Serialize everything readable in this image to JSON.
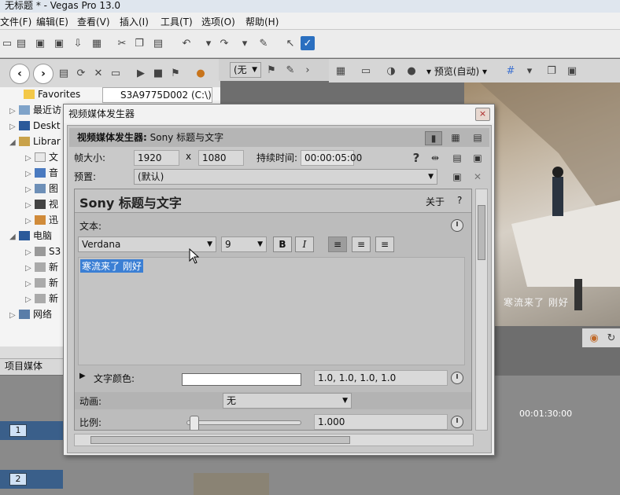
{
  "window": {
    "title": "无标题 * - Vegas Pro 13.0"
  },
  "menu": [
    "文件(F)",
    "编辑(E)",
    "查看(V)",
    "插入(I)",
    "工具(T)",
    "选项(O)",
    "帮助(H)"
  ],
  "explorer": {
    "path": "S3A9775D002 (C:\\)",
    "tree": [
      {
        "label": "Favorites"
      },
      {
        "label": "最近访"
      },
      {
        "label": "Deskt"
      },
      {
        "label": "Librar"
      },
      {
        "label": "文"
      },
      {
        "label": "音"
      },
      {
        "label": "图"
      },
      {
        "label": "视"
      },
      {
        "label": "迅"
      },
      {
        "label": "电脑"
      },
      {
        "label": "S3"
      },
      {
        "label": "新"
      },
      {
        "label": "新"
      },
      {
        "label": "新"
      },
      {
        "label": "网络"
      }
    ],
    "tab": "项目媒体"
  },
  "trim": {
    "dropdown": "(无"
  },
  "preview": {
    "quality": "预览(自动)",
    "subtitle": "寒流来了 刚好"
  },
  "timeline": {
    "time": "00:01:30:00",
    "track1": "1",
    "track2": "2"
  },
  "dialog": {
    "title": "视频媒体发生器",
    "header_label": "视频媒体发生器:",
    "header_value": "Sony 标题与文字",
    "frame_size_label": "帧大小:",
    "width": "1920",
    "x": "x",
    "height": "1080",
    "duration_label": "持续时间:",
    "duration": "00:00:05:00",
    "preset_label": "预置:",
    "preset_value": "(默认)",
    "plugin_title": "Sony 标题与文字",
    "about": "关于",
    "help": "?",
    "text_label": "文本:",
    "font": "Verdana",
    "font_size": "9",
    "bold": "B",
    "italic": "I",
    "text_content": "寒流来了 刚好",
    "text_color_label": "文字颜色:",
    "text_color_value": "1.0, 1.0, 1.0, 1.0",
    "animation_label": "动画:",
    "animation_value": "无",
    "scale_label": "比例:",
    "scale_value": "1.000",
    "close": "×"
  },
  "icons": [
    "new-icon",
    "open-icon",
    "save-icon",
    "cut-icon",
    "copy-icon",
    "paste-icon",
    "undo-icon",
    "redo-icon",
    "back-icon",
    "forward-icon",
    "clock-icon",
    "help-icon",
    "close-icon"
  ],
  "colors": {
    "selection": "#3b7fd4",
    "track_header": "#3a5f8a"
  }
}
